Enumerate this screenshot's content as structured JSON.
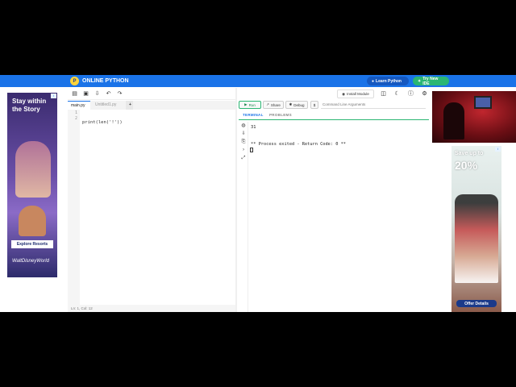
{
  "header": {
    "brand": "ONLINE PYTHON",
    "learn_python": "Learn Python",
    "try_new_ide": "Try New IDE"
  },
  "ad_left": {
    "headline": "Stay within the Story",
    "cta": "Explore Resorts",
    "brand_line": "WaltDisneyWorld"
  },
  "editor": {
    "tabs": [
      "main.py",
      "Untitled1.py"
    ],
    "add_tab": "+",
    "line_numbers": [
      "1",
      "2"
    ],
    "code_lines": [
      "print(len('ǃ'))",
      ""
    ],
    "status": "Ln: 1,  Col: 12"
  },
  "toolbar": {
    "install_module": "Install Module",
    "run": "Run",
    "share": "Share",
    "debug": "Debug",
    "dollar": "$",
    "args_placeholder": "Command Line Arguments"
  },
  "terminal": {
    "tabs": [
      "TERMINAL",
      "PROBLEMS"
    ],
    "output": "31\n\n\n** Process exited - Return Code: 0 **"
  },
  "ad_right": {
    "headline": "Save up to",
    "percent": "20%",
    "cta": "Offer Details"
  },
  "icons": [
    "open-file-icon",
    "save-icon",
    "download-icon",
    "undo-icon",
    "redo-icon",
    "layout-icon",
    "dark-mode-icon",
    "info-icon",
    "settings-icon"
  ],
  "colors": {
    "header": "#1a73e8",
    "learn_btn": "#1558c0",
    "try_btn": "#2bb673",
    "run": "#2bb673"
  }
}
